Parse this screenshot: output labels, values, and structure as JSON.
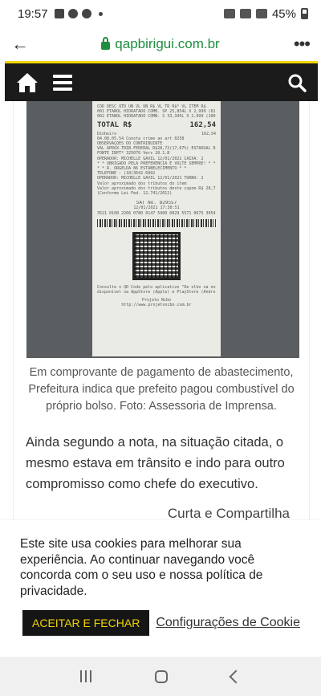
{
  "status_bar": {
    "time": "19:57",
    "battery": "45%"
  },
  "browser": {
    "domain": "qapbirigui.com.br"
  },
  "receipt": {
    "lines_top": [
      "COD  DESC  QTD  UN  VL UN R$   VL TR R$*   VL ITEM R$",
      "001 ETANOL HIDRATADO COMB.  SP  25,854L X 2,999 (62,54) 62,54",
      "002 ETANOL HIDRATADO COMB.  S 33,345L X 2,999 (100,00) 100,00"
    ],
    "total_label": "TOTAL R$",
    "total_value": "162,54",
    "payment_method": "Dinheiro",
    "payment_value": "162,54",
    "lines_mid": [
      "04.08.05.54 Consta crime ao art 0258",
      "OBSERVAÇÕES DO CONTRIBUINTE",
      "VAL APROX.TRIB.FEDERAL R$28,72(17,67%) ESTADUAL R$29,26(18,00%)",
      "FONTE IBPT* 325070 Vers 20.1.B",
      "OPERADOR: MICHELLE GAVIL 12/01/2021 CAIXA: 2",
      "* * OBRIGADO PELA PREFERENCIA E VOLTE SEMPRE! * *",
      "* * R. ORGELDA 86 ESTABELECIMENTO * *",
      "TELEFONE : (18)3642-6992",
      "OPERADOR: MICHELLE GAVIL 12/01/2021 TURNO: 2",
      "Valor aproximado dos tributos do item",
      "Valor aproximado dos tributos deste cupom R$   28,72",
      "(Conforme Lei Fed. 12.741/2012)"
    ],
    "sat_number": "SAT No. 829557",
    "sat_datetime": "12/01/2021 17:30:51",
    "sat_key": "3521 0108 2266 0780 0147 5900 0829 5571 0675 3054 7325",
    "lines_bottom": [
      "Consulte o QR Code pelo aplicativo \"De olho na nota\",",
      "disponível na AppStore (Apple) e PlayStore (Android)",
      "Projeto Nibo",
      "http://www.projetonibo.com.br"
    ]
  },
  "article": {
    "caption": "Em comprovante de pagamento de abastecimento, Prefeitura indica que prefeito pagou combustível do próprio bolso. Foto: Assessoria de Imprensa.",
    "paragraph": "Ainda segundo a nota, na situação citada, o mesmo estava em trânsito e indo para outro compromisso como chefe do executivo.",
    "share_heading": "Curta e Compartilha"
  },
  "cookie_banner": {
    "text": "Este site usa cookies para melhorar sua experiência. Ao continuar navegando você concorda com o seu uso e nossa política de privacidade.",
    "accept_label": "ACEITAR E FECHAR",
    "settings_label": "Configurações de Cookie"
  },
  "colors": {
    "header_bg": "#1b1b1b",
    "accent_yellow": "#f2d500",
    "url_green": "#1e8e3e"
  },
  "icons": {
    "header_left": "home-icon",
    "header_menu": "hamburger-icon",
    "header_right": "search-icon",
    "browser_back": "arrow-left-icon",
    "browser_menu": "more-vert-icon",
    "url_secure": "lock-icon"
  }
}
